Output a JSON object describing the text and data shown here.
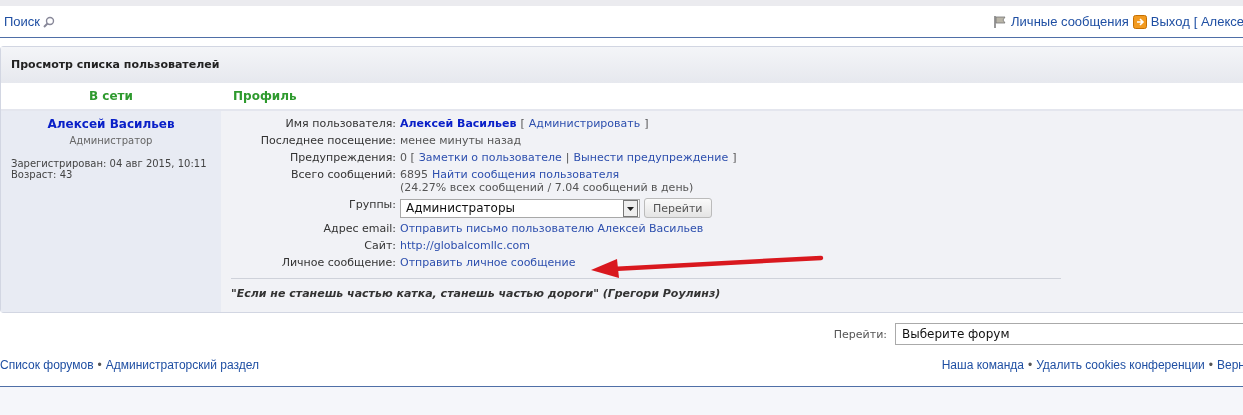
{
  "header": {
    "search_link": "Поиск",
    "messages_link": "Личные сообщения",
    "logout_link": "Выход",
    "user_link": "[ Алексе"
  },
  "panel": {
    "title": "Просмотр списка пользователей",
    "column_headers": [
      "В сети",
      "Профиль"
    ],
    "user": {
      "name": "Алексей Васильев",
      "rank": "Администратор",
      "details": [
        "Зарегистрирован: 04 авг 2015, 10:11",
        "Возраст: 43"
      ]
    },
    "fields": [
      {
        "label": "Имя пользователя:",
        "kind": "parts",
        "parts": [
          {
            "kind": "name",
            "text": "Алексей Васильев"
          },
          {
            "kind": "text",
            "text": "["
          },
          {
            "kind": "link",
            "text": "Администрировать"
          },
          {
            "kind": "text",
            "text": "]"
          }
        ]
      },
      {
        "label": "Последнее посещение:",
        "kind": "parts",
        "parts": [
          {
            "kind": "text",
            "text": "менее минуты назад"
          }
        ]
      },
      {
        "label": "Предупреждения:",
        "kind": "parts",
        "parts": [
          {
            "kind": "text",
            "text": "0 ["
          },
          {
            "kind": "link",
            "text": "Заметки о пользователе"
          },
          {
            "kind": "text",
            "text": "|"
          },
          {
            "kind": "link",
            "text": "Вынести предупреждение"
          },
          {
            "kind": "text",
            "text": "]"
          }
        ]
      },
      {
        "label": "Всего сообщений:",
        "kind": "parts",
        "parts": [
          {
            "kind": "text",
            "text": "6895"
          },
          {
            "kind": "link",
            "text": "Найти сообщения пользователя"
          },
          {
            "kind": "line",
            "text": "(24.27% всех сообщений / 7.04 сообщений в день)"
          }
        ]
      },
      {
        "label": "Группы:",
        "kind": "select",
        "value": "Администраторы",
        "button": "Перейти"
      },
      {
        "label": "Адрес email:",
        "kind": "parts",
        "parts": [
          {
            "kind": "link",
            "text": "Отправить письмо пользователю Алексей Васильев"
          }
        ]
      },
      {
        "label": "Сайт:",
        "kind": "parts",
        "parts": [
          {
            "kind": "link",
            "text": "http://globalcomllc.com"
          }
        ]
      },
      {
        "label": "Личное сообщение:",
        "kind": "parts",
        "parts": [
          {
            "kind": "link",
            "text": "Отправить личное сообщение"
          }
        ]
      }
    ],
    "signature": "\"Если не станешь частью катка, станешь частью дороги\" (Грегори Роулинз)"
  },
  "jump": {
    "label": "Перейти:",
    "value": "Выберите форум"
  },
  "footer": {
    "separator": "•",
    "left_links": [
      "Список форумов",
      "Администраторский раздел"
    ],
    "right_links": [
      "Наша команда",
      "Удалить cookies конференции",
      "Верн"
    ]
  }
}
